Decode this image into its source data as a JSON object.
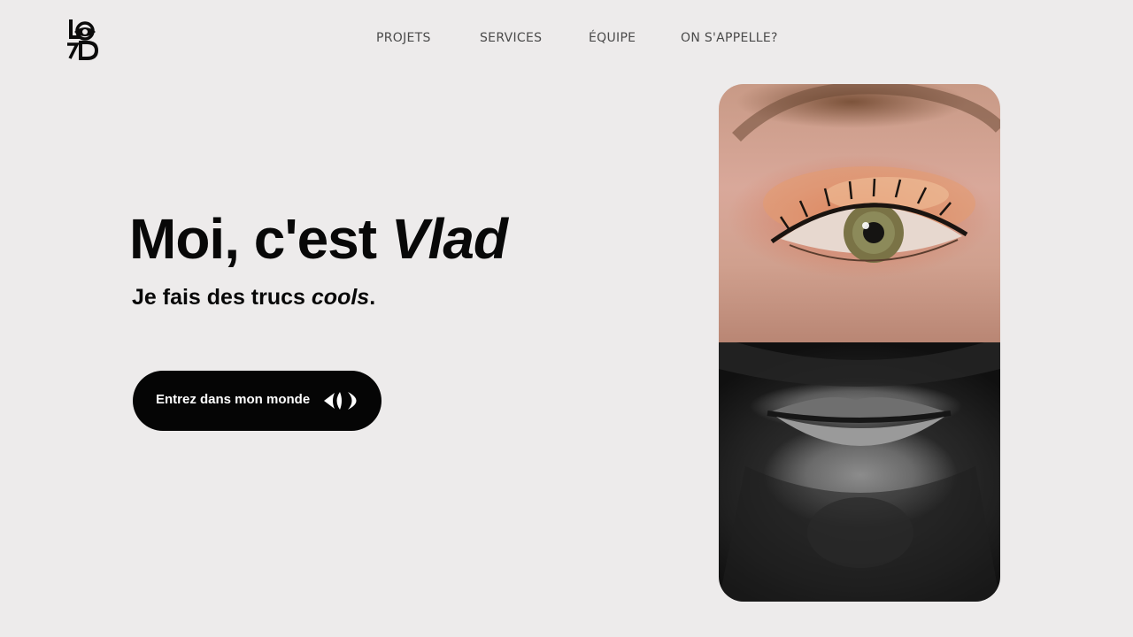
{
  "brand": {
    "logo_text": "LVD",
    "logo_icon": "eye-logo-icon"
  },
  "nav": {
    "items": [
      {
        "label": "PROJETS"
      },
      {
        "label": "SERVICES"
      },
      {
        "label": "ÉQUIPE"
      },
      {
        "label": "ON S'APPELLE?"
      }
    ]
  },
  "hero": {
    "title_prefix": "Moi, c'est ",
    "title_name": "Vlad",
    "subtitle_prefix": "Je fais des trucs ",
    "subtitle_emphasis": "cools",
    "subtitle_suffix": ".",
    "cta_label": "Entrez dans mon monde",
    "cta_icon": "eye-arrows-icon"
  },
  "photos": {
    "top": "eye-closeup-photo",
    "bottom": "beard-closeup-photo"
  },
  "colors": {
    "background": "#edebeb",
    "text": "#080808",
    "nav_text": "#4a4a4a",
    "cta_bg": "#050505",
    "cta_text": "#ffffff"
  }
}
